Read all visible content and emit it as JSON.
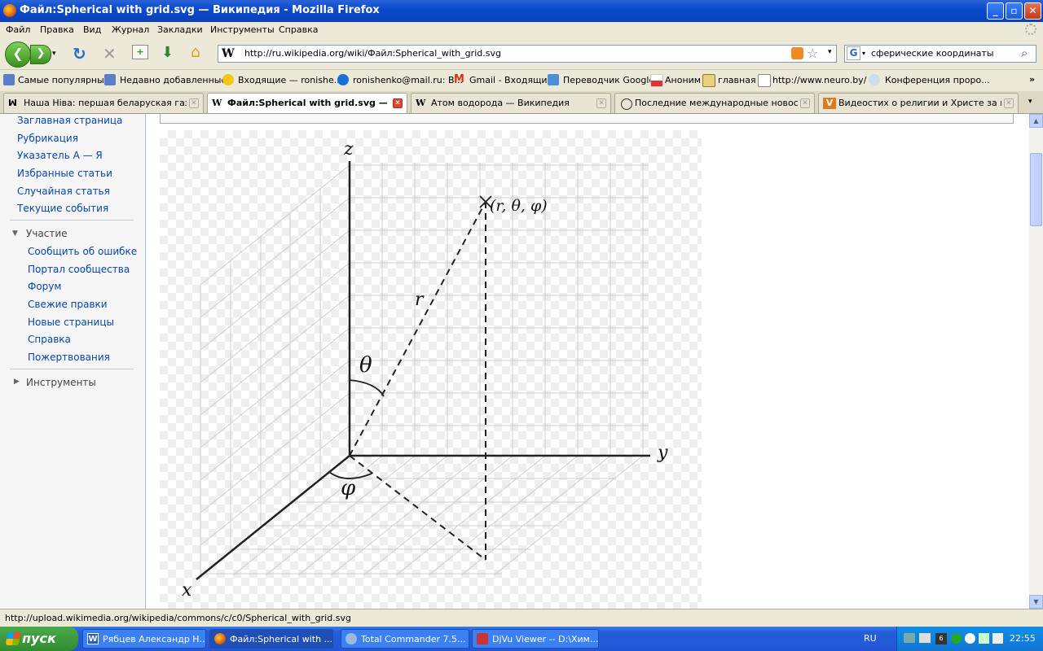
{
  "window": {
    "title": "Файл:Spherical with grid.svg — Википедия - Mozilla Firefox"
  },
  "menu": [
    "Файл",
    "Правка",
    "Вид",
    "Журнал",
    "Закладки",
    "Инструменты",
    "Справка"
  ],
  "navbar": {
    "url": "http://ru.wikipedia.org/wiki/Файл:Spherical_with_grid.svg",
    "search_value": "сферические координаты"
  },
  "bookmarks": [
    "Самые популярные",
    "Недавно добавленные",
    "Входящие — ronishe...",
    "ronishenko@mail.ru: В...",
    "Gmail - Входящие",
    "Переводчик Google",
    "Аноним",
    "главная",
    "http://www.neuro.by/",
    "Конференция проро..."
  ],
  "tabs": [
    {
      "label": "Наша Ніва: першая беларуская газета",
      "icon": "nn"
    },
    {
      "label": "Файл:Spherical with grid.svg — В...",
      "icon": "W"
    },
    {
      "label": "Атом водорода — Википедия",
      "icon": "W"
    },
    {
      "label": "Последние международные новости ...",
      "icon": "o"
    },
    {
      "label": "Видеостих о религии и Христе за не...",
      "icon": "V"
    }
  ],
  "sidebar": {
    "nav_links": [
      "Заглавная страница",
      "Рубрикация",
      "Указатель А — Я",
      "Избранные статьи",
      "Случайная статья",
      "Текущие события"
    ],
    "section_participate": "Участие",
    "participate_links": [
      "Сообщить об ошибке",
      "Портал сообщества",
      "Форум",
      "Свежие правки",
      "Новые страницы",
      "Справка",
      "Пожертвования"
    ],
    "section_tools": "Инструменты"
  },
  "figure": {
    "axis_z": "z",
    "axis_y": "y",
    "axis_x": "x",
    "point_label": "(r, θ,   φ)",
    "r_label": "r",
    "theta_label": "θ",
    "phi_label": "φ"
  },
  "status": {
    "text": "http://upload.wikimedia.org/wikipedia/commons/c/c0/Spherical_with_grid.svg"
  },
  "taskbar": {
    "start": "пуск",
    "tasks": [
      "Рябцев Александр Н...",
      "Файл:Spherical with ...",
      "Total Commander 7.5...",
      "DjVu Viewer -- D:\\Хим..."
    ],
    "lang": "RU",
    "time": "22:55"
  },
  "colors": {
    "link": "#0645ad",
    "titlebar": "#0b4bd0",
    "taskbar": "#245edb",
    "start": "#2f8d2f"
  }
}
